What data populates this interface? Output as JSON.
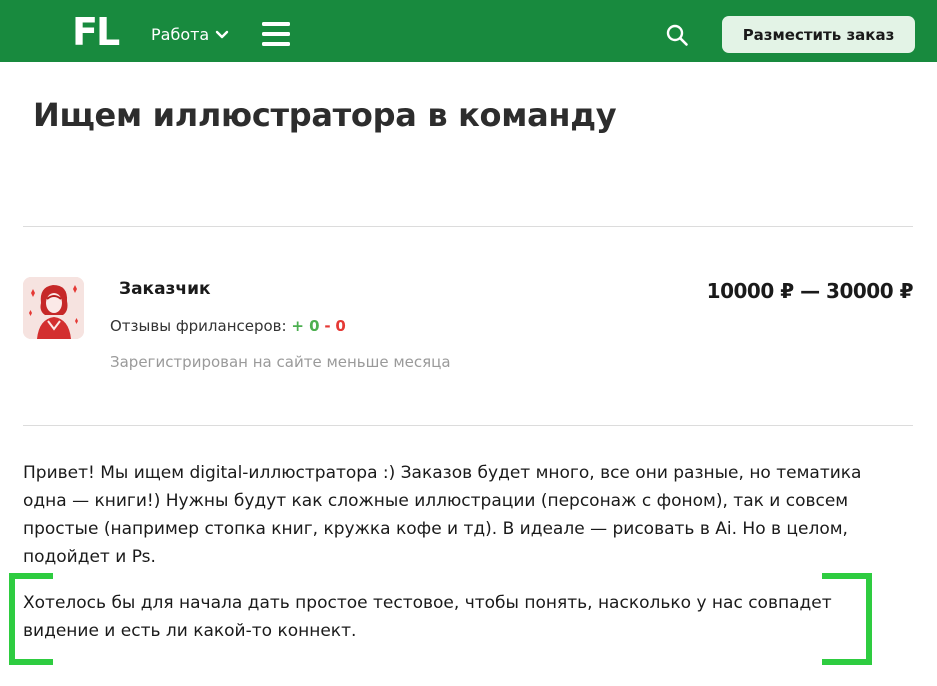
{
  "header": {
    "logo": "FL",
    "nav_work_label": "Работа",
    "place_order_label": "Разместить заказ",
    "background_color": "#188a3e"
  },
  "project": {
    "title": "Ищем иллюстратора в команду",
    "price": "10000 ₽ — 30000 ₽"
  },
  "customer": {
    "label": "Заказчик",
    "reviews_label": "Отзывы фрилансеров:",
    "reviews_positive": "+ 0",
    "reviews_separator": "-",
    "reviews_negative": "0",
    "registered": "Зарегистрирован на сайте меньше месяца"
  },
  "description": {
    "paragraph1": "Привет! Мы ищем digital-иллюстратора :) Заказов будет много, все они разные, но тематика одна — книги!) Нужны будут как сложные иллюстрации (персонаж с фоном), так и совсем простые (например стопка книг, кружка кофе и тд). В идеале — рисовать в Ai. Но в целом, подойдет и Ps.",
    "paragraph2": "Хотелось бы для начала дать простое тестовое, чтобы понять, насколько у нас совпадет видение и есть ли какой-то коннект."
  },
  "colors": {
    "highlight_bracket": "#2ecc40",
    "positive": "#4caf50",
    "negative": "#e53935"
  },
  "icons": [
    "chevron-down-icon",
    "menu-icon",
    "search-icon"
  ]
}
